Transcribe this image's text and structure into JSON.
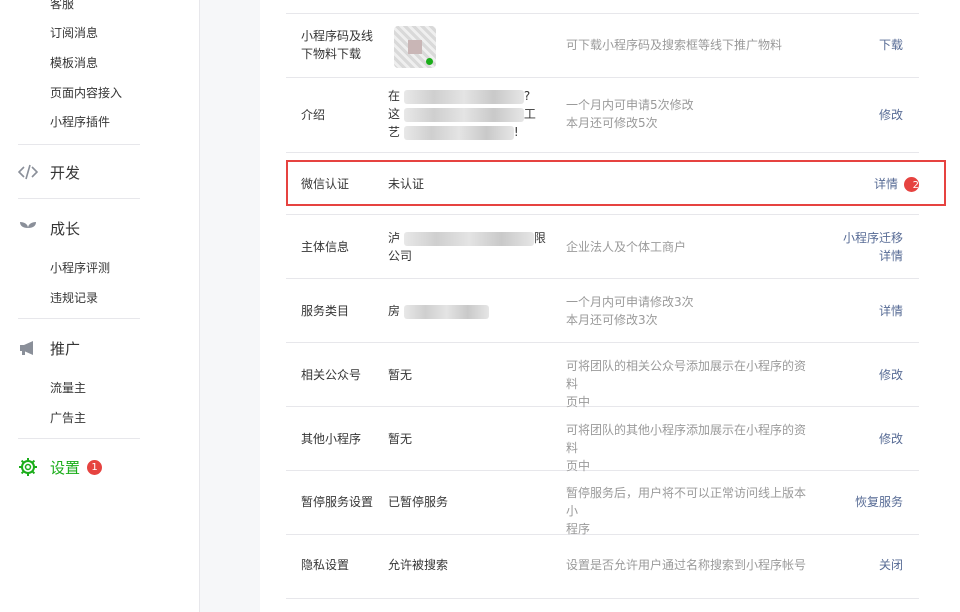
{
  "sidebar": {
    "top_items": [
      {
        "label": "客服"
      },
      {
        "label": "订阅消息"
      },
      {
        "label": "模板消息"
      },
      {
        "label": "页面内容接入"
      },
      {
        "label": "小程序插件"
      }
    ],
    "develop": {
      "label": "开发",
      "icon": "code-icon"
    },
    "growth": {
      "label": "成长",
      "icon": "sprout-icon",
      "items": [
        {
          "label": "小程序评测"
        },
        {
          "label": "违规记录"
        }
      ]
    },
    "promote": {
      "label": "推广",
      "icon": "megaphone-icon",
      "items": [
        {
          "label": "流量主"
        },
        {
          "label": "广告主"
        }
      ]
    },
    "settings": {
      "label": "设置",
      "icon": "gear-icon",
      "badge": "1",
      "active_color": "#1aad19"
    }
  },
  "rows": [
    {
      "label": "小程序码及线下物料下载",
      "desc": "可下载小程序码及搜索框等线下推广物料",
      "action": "下载"
    },
    {
      "label": "介绍",
      "value_lines": [
        "在",
        "?",
        "这",
        "工",
        "艺",
        "!"
      ],
      "desc_lines": [
        "一个月内可申请5次修改",
        "本月还可修改5次"
      ],
      "action": "修改"
    },
    {
      "label": "微信认证",
      "value": "未认证",
      "action": "详情",
      "badge": "2"
    },
    {
      "label": "主体信息",
      "value_lines": [
        "泸",
        "限",
        "公司"
      ],
      "desc": "企业法人及个体工商户",
      "actions": [
        "小程序迁移",
        "详情"
      ]
    },
    {
      "label": "服务类目",
      "value_lines": [
        "房"
      ],
      "desc_lines": [
        "一个月内可申请修改3次",
        "本月还可修改3次"
      ],
      "action": "详情"
    },
    {
      "label": "相关公众号",
      "value": "暂无",
      "desc_lines": [
        "可将团队的相关公众号添加展示在小程序的资料",
        "页中"
      ],
      "action": "修改"
    },
    {
      "label": "其他小程序",
      "value": "暂无",
      "desc_lines": [
        "可将团队的其他小程序添加展示在小程序的资料",
        "页中"
      ],
      "action": "修改"
    },
    {
      "label": "暂停服务设置",
      "value": "已暂停服务",
      "desc_lines": [
        "暂停服务后，用户将不可以正常访问线上版本小",
        "程序"
      ],
      "action": "恢复服务"
    },
    {
      "label": "隐私设置",
      "value": "允许被搜索",
      "desc": "设置是否允许用户通过名称搜索到小程序帐号",
      "action": "关闭"
    }
  ],
  "colors": {
    "accent": "#1aad19",
    "link": "#576b95",
    "badge": "#e64340",
    "highlight": "#e64340"
  }
}
